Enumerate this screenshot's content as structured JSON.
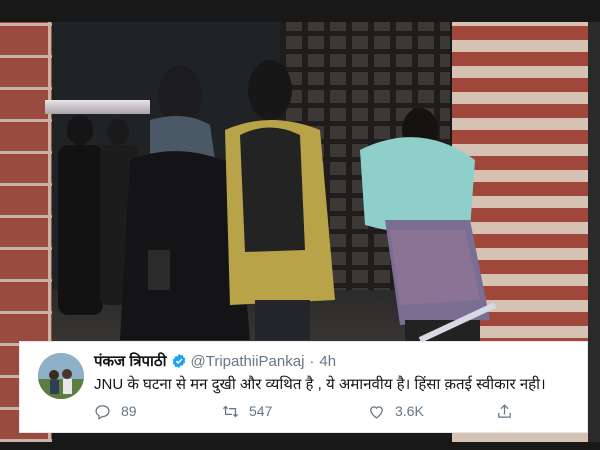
{
  "tweet": {
    "display_name": "पंकज त्रिपाठी",
    "handle": "@TripathiiPankaj",
    "separator": "·",
    "time": "4h",
    "text": "JNU के घटना से मन दुखी और व्यथित है , ये अमानवीय है। हिंसा क़तई स्वीकार नही।",
    "actions": {
      "reply_count": "89",
      "retweet_count": "547",
      "like_count": "3.6K"
    },
    "verified_color": "#1da1f2",
    "icon_color": "#657786"
  },
  "photo": {
    "description_icons": [
      "brick-wall",
      "masked-people"
    ]
  }
}
